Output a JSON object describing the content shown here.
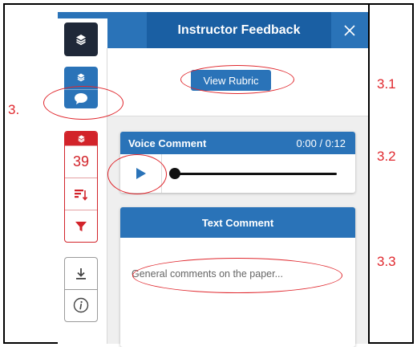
{
  "panel": {
    "title": "Instructor Feedback",
    "rubric_button": "View Rubric"
  },
  "sidebar": {
    "count": "39"
  },
  "voice_comment": {
    "label": "Voice Comment",
    "time": "0:00 / 0:12",
    "progress": 0
  },
  "text_comment": {
    "label": "Text Comment",
    "placeholder": "General comments on the paper..."
  },
  "annotations": {
    "main": "3.",
    "a": "3.1",
    "b": "3.2",
    "c": "3.3"
  },
  "colors": {
    "accent": "#2a73b8",
    "dark_accent": "#1a5fa3",
    "alert": "#d2232a",
    "annotation": "#e0282e"
  }
}
